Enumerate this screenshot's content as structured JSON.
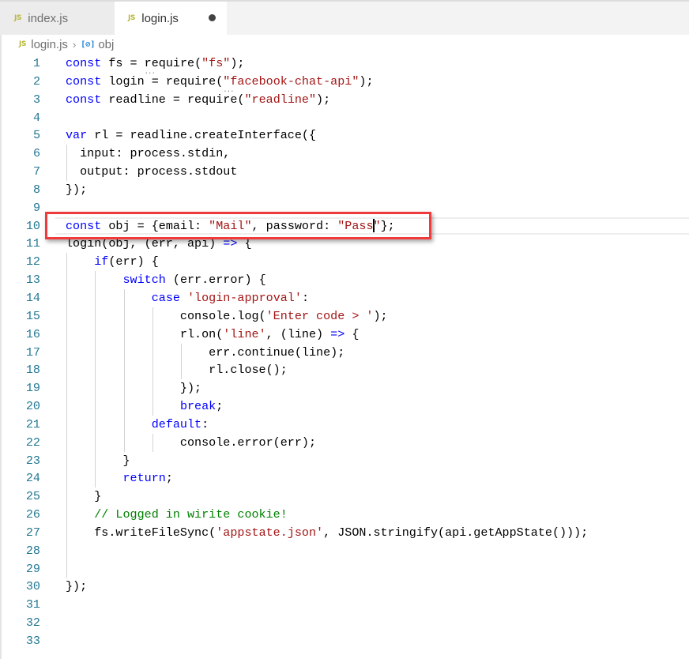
{
  "tabs": [
    {
      "icon": "JS",
      "label": "index.js",
      "active": false,
      "dirty": false
    },
    {
      "icon": "JS",
      "label": "login.js",
      "active": true,
      "dirty": true
    }
  ],
  "breadcrumb": {
    "file_icon": "JS",
    "file": "login.js",
    "separator": "›",
    "symbol_icon": "[⊘]",
    "symbol": "obj"
  },
  "colors": {
    "keyword": "#0000ff",
    "string": "#a31515",
    "comment": "#008000",
    "line_number": "#237893",
    "annotation_box": "#ef3b3b"
  },
  "editor": {
    "current_line": 10,
    "annotation": {
      "line": 10,
      "label": "highlighted line"
    },
    "lines": [
      {
        "n": "1",
        "tokens": [
          [
            "kw",
            "const"
          ],
          [
            "",
            "fs = "
          ],
          [
            "sq",
            "r"
          ],
          [
            "",
            "equire("
          ],
          [
            "str",
            "\"fs\""
          ],
          [
            "",
            ");"
          ]
        ]
      },
      {
        "n": "2",
        "tokens": [
          [
            "kw",
            "const"
          ],
          [
            "",
            "login = require("
          ],
          [
            "sqs",
            "\""
          ],
          [
            "str",
            "facebook-chat-api\""
          ],
          [
            "",
            ");"
          ]
        ]
      },
      {
        "n": "3",
        "tokens": [
          [
            "kw",
            "const"
          ],
          [
            "",
            "readline = require("
          ],
          [
            "str",
            "\"readline\""
          ],
          [
            "",
            ");"
          ]
        ]
      },
      {
        "n": "4",
        "tokens": []
      },
      {
        "n": "5",
        "tokens": [
          [
            "kw",
            "var"
          ],
          [
            "",
            "rl = readline.createInterface({"
          ]
        ]
      },
      {
        "n": "6",
        "tokens": [
          [
            "",
            "  input: process.stdin,"
          ]
        ]
      },
      {
        "n": "7",
        "tokens": [
          [
            "",
            "  output: process.stdout"
          ]
        ]
      },
      {
        "n": "8",
        "tokens": [
          [
            "",
            "});"
          ]
        ]
      },
      {
        "n": "9",
        "tokens": []
      },
      {
        "n": "10",
        "tokens": [
          [
            "kw",
            "const"
          ],
          [
            "",
            "obj = {email: "
          ],
          [
            "str",
            "\"Mail\""
          ],
          [
            "",
            ", password: "
          ],
          [
            "str",
            "\"Pass"
          ],
          [
            "cur",
            ""
          ],
          [
            "str",
            "\""
          ],
          [
            "",
            "};"
          ]
        ]
      },
      {
        "n": "11",
        "tokens": [
          [
            "",
            "login(obj, (err, api) "
          ],
          [
            "kw",
            "=>"
          ],
          [
            "",
            " {"
          ]
        ]
      },
      {
        "n": "12",
        "tokens": [
          [
            "",
            "    "
          ],
          [
            "kw",
            "if"
          ],
          [
            "",
            "(err) {"
          ]
        ]
      },
      {
        "n": "13",
        "tokens": [
          [
            "",
            "        "
          ],
          [
            "kw",
            "switch"
          ],
          [
            "",
            " (err.error) {"
          ]
        ]
      },
      {
        "n": "14",
        "tokens": [
          [
            "",
            "            "
          ],
          [
            "kw",
            "case"
          ],
          [
            "",
            " "
          ],
          [
            "str",
            "'login-approval'"
          ],
          [
            "",
            ":"
          ]
        ]
      },
      {
        "n": "15",
        "tokens": [
          [
            "",
            "                console.log("
          ],
          [
            "str",
            "'Enter code > '"
          ],
          [
            "",
            ");"
          ]
        ]
      },
      {
        "n": "16",
        "tokens": [
          [
            "",
            "                rl.on("
          ],
          [
            "str",
            "'line'"
          ],
          [
            "",
            ", (line) "
          ],
          [
            "kw",
            "=>"
          ],
          [
            "",
            " {"
          ]
        ]
      },
      {
        "n": "17",
        "tokens": [
          [
            "",
            "                    err.continue(line);"
          ]
        ]
      },
      {
        "n": "18",
        "tokens": [
          [
            "",
            "                    rl.close();"
          ]
        ]
      },
      {
        "n": "19",
        "tokens": [
          [
            "",
            "                });"
          ]
        ]
      },
      {
        "n": "20",
        "tokens": [
          [
            "",
            "                "
          ],
          [
            "kw",
            "break"
          ],
          [
            "",
            ";"
          ]
        ]
      },
      {
        "n": "21",
        "tokens": [
          [
            "",
            "            "
          ],
          [
            "kw",
            "default"
          ],
          [
            "",
            ":"
          ]
        ]
      },
      {
        "n": "22",
        "tokens": [
          [
            "",
            "                console.error(err);"
          ]
        ]
      },
      {
        "n": "23",
        "tokens": [
          [
            "",
            "        }"
          ]
        ]
      },
      {
        "n": "24",
        "tokens": [
          [
            "",
            "        "
          ],
          [
            "kw",
            "return"
          ],
          [
            "",
            ";"
          ]
        ]
      },
      {
        "n": "25",
        "tokens": [
          [
            "",
            "    }"
          ]
        ]
      },
      {
        "n": "26",
        "tokens": [
          [
            "",
            "    "
          ],
          [
            "cm",
            "// Logged in wirite cookie!"
          ]
        ]
      },
      {
        "n": "27",
        "tokens": [
          [
            "",
            "    fs.writeFileSync("
          ],
          [
            "str",
            "'appstate.json'"
          ],
          [
            "",
            ", JSON.stringify(api.getAppState()));"
          ]
        ]
      },
      {
        "n": "28",
        "tokens": []
      },
      {
        "n": "29",
        "tokens": []
      },
      {
        "n": "30",
        "tokens": [
          [
            "",
            "});"
          ]
        ]
      },
      {
        "n": "31",
        "tokens": []
      },
      {
        "n": "32",
        "tokens": []
      },
      {
        "n": "33",
        "tokens": []
      }
    ]
  }
}
